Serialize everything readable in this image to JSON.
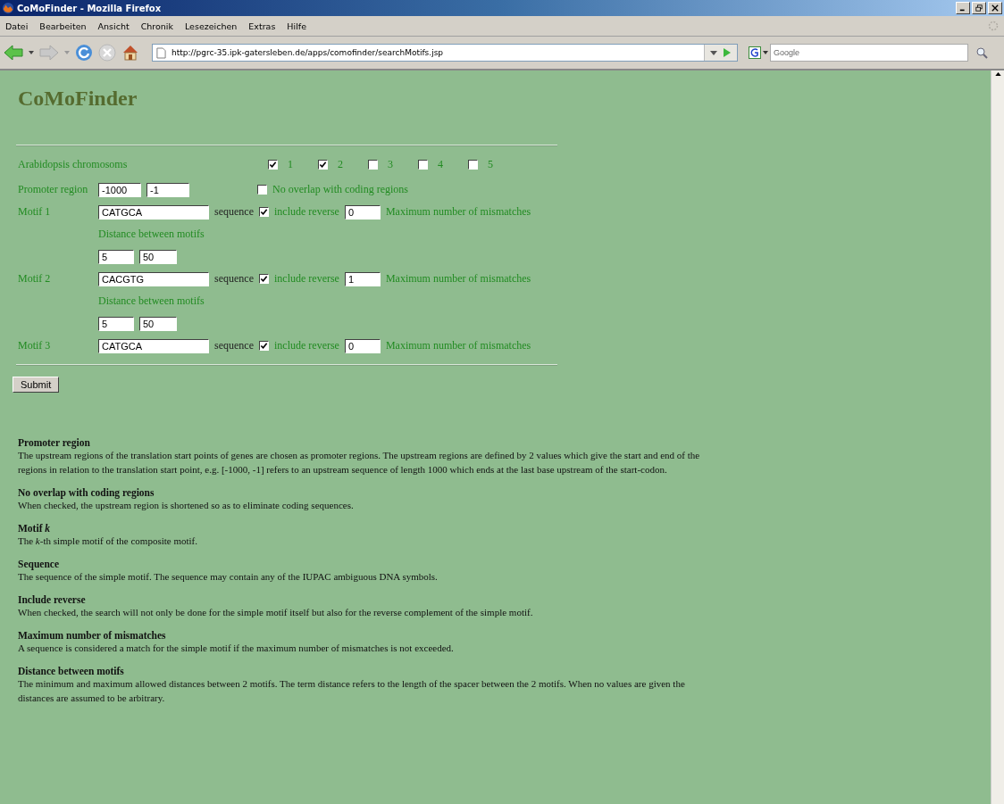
{
  "window": {
    "title": "CoMoFinder - Mozilla Firefox"
  },
  "menu": [
    "Datei",
    "Bearbeiten",
    "Ansicht",
    "Chronik",
    "Lesezeichen",
    "Extras",
    "Hilfe"
  ],
  "toolbar": {
    "url": "http://pgrc-35.ipk-gatersleben.de/apps/comofinder/searchMotifs.jsp",
    "search_placeholder": "Google"
  },
  "page": {
    "title": "CoMoFinder",
    "chromosomes": {
      "label": "Arabidopsis chromosoms",
      "options": [
        {
          "label": "1",
          "checked": true
        },
        {
          "label": "2",
          "checked": true
        },
        {
          "label": "3",
          "checked": false
        },
        {
          "label": "4",
          "checked": false
        },
        {
          "label": "5",
          "checked": false
        }
      ]
    },
    "promoter": {
      "label": "Promoter region",
      "from": "-1000",
      "to": "-1",
      "no_overlap": {
        "label": "No overlap with coding regions",
        "checked": false
      }
    },
    "rows": [
      {
        "kind": "motif",
        "label": "Motif 1",
        "sequence": "CATGCA",
        "sequence_label": "sequence",
        "include_reverse": {
          "label": "include reverse",
          "checked": true
        },
        "mismatches": "0",
        "mismatches_label": "Maximum number of mismatches"
      },
      {
        "kind": "distance",
        "label": "Distance between motifs",
        "min": "5",
        "max": "50"
      },
      {
        "kind": "motif",
        "label": "Motif 2",
        "sequence": "CACGTG",
        "sequence_label": "sequence",
        "include_reverse": {
          "label": "include reverse",
          "checked": true
        },
        "mismatches": "1",
        "mismatches_label": "Maximum number of mismatches"
      },
      {
        "kind": "distance",
        "label": "Distance between motifs",
        "min": "5",
        "max": "50"
      },
      {
        "kind": "motif",
        "label": "Motif 3",
        "sequence": "CATGCA",
        "sequence_label": "sequence",
        "include_reverse": {
          "label": "include reverse",
          "checked": true
        },
        "mismatches": "0",
        "mismatches_label": "Maximum number of mismatches"
      }
    ],
    "submit": "Submit",
    "help": [
      {
        "heading": "Promoter region",
        "text": "The upstream regions of the translation start points of genes are chosen as promoter regions. The upstream regions are defined by 2 values which give the start and end of the regions in relation to the translation start point, e.g. [-1000, -1] refers to an upstream sequence of length 1000 which ends at the last base upstream of the start-codon."
      },
      {
        "heading": "No overlap with coding regions",
        "text": "When checked, the upstream region is shortened so as to eliminate coding sequences."
      },
      {
        "heading": "Motif *k*",
        "text": "The *k*-th simple motif of the composite motif."
      },
      {
        "heading": "Sequence",
        "text": "The sequence of the simple motif. The sequence may contain any of the IUPAC ambiguous DNA symbols."
      },
      {
        "heading": "Include reverse",
        "text": "When checked, the search will not only be done for the simple motif itself but also for the reverse complement of the simple motif."
      },
      {
        "heading": "Maximum number of mismatches",
        "text": "A sequence is considered a match for the simple motif if the maximum number of mismatches is not exceeded."
      },
      {
        "heading": "Distance between motifs",
        "text": "The minimum and maximum allowed distances between 2 motifs. The term distance refers to the length of the spacer between the 2 motifs. When no values are given the distances are assumed to be arbitrary."
      }
    ]
  }
}
